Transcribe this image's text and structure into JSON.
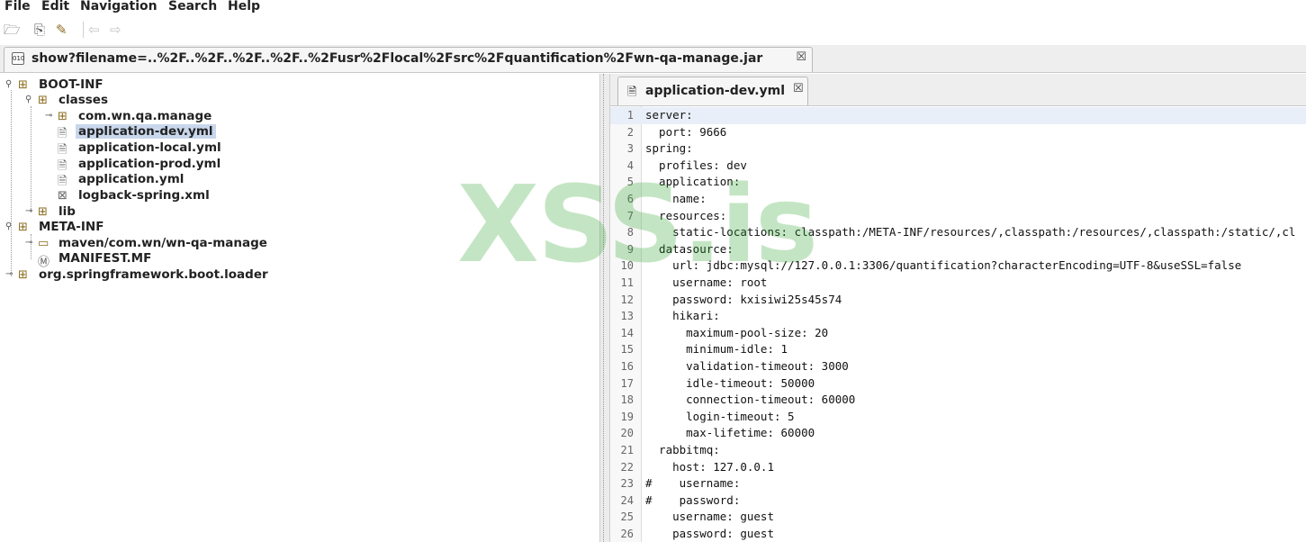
{
  "menu": [
    "File",
    "Edit",
    "Navigation",
    "Search",
    "Help"
  ],
  "toolbar": {
    "icons": [
      "open-folder-icon",
      "open-archive-icon",
      "wand-icon",
      "back-arrow-icon",
      "forward-arrow-icon"
    ]
  },
  "outer_tab": {
    "label": "show?filename=..%2F..%2F..%2F..%2F..%2Fusr%2Flocal%2Fsrc%2Fquantification%2Fwn-qa-manage.jar",
    "close": "☒"
  },
  "tree": [
    {
      "label": "BOOT-INF",
      "type": "package",
      "expanded": true
    },
    {
      "label": "classes",
      "type": "package",
      "expanded": true
    },
    {
      "label": "com.wn.qa.manage",
      "type": "package",
      "expanded": false
    },
    {
      "label": "application-dev.yml",
      "type": "file",
      "selected": true
    },
    {
      "label": "application-local.yml",
      "type": "file"
    },
    {
      "label": "application-prod.yml",
      "type": "file"
    },
    {
      "label": "application.yml",
      "type": "file"
    },
    {
      "label": "logback-spring.xml",
      "type": "xml"
    },
    {
      "label": "lib",
      "type": "package",
      "expanded": false
    },
    {
      "label": "META-INF",
      "type": "package",
      "expanded": true
    },
    {
      "label": "maven/com.wn/wn-qa-manage",
      "type": "folder",
      "expanded": false
    },
    {
      "label": "MANIFEST.MF",
      "type": "manifest"
    },
    {
      "label": "org.springframework.boot.loader",
      "type": "package",
      "expanded": false
    }
  ],
  "editor": {
    "tab_label": "application-dev.yml",
    "tab_close": "☒",
    "lines": [
      "server:",
      "  port: 9666",
      "spring:",
      "  profiles: dev",
      "  application:",
      "    name: ",
      "  resources:",
      "    static-locations: classpath:/META-INF/resources/,classpath:/resources/,classpath:/static/,cl",
      "  datasource:",
      "    url: jdbc:mysql://127.0.0.1:3306/quantification?characterEncoding=UTF-8&useSSL=false",
      "    username: root",
      "    password: kxisiwi25s45s74",
      "    hikari:",
      "      maximum-pool-size: 20",
      "      minimum-idle: 1",
      "      validation-timeout: 3000",
      "      idle-timeout: 50000",
      "      connection-timeout: 60000",
      "      login-timeout: 5",
      "      max-lifetime: 60000",
      "  rabbitmq:",
      "    host: 127.0.0.1",
      "#    username:",
      "#    password:",
      "    username: guest",
      "    password: guest"
    ]
  },
  "watermark": "XSS.is",
  "colors": {
    "selection": "#c9d7ec",
    "watermark": "#2fa52f",
    "current_line": "#e9eff8"
  }
}
